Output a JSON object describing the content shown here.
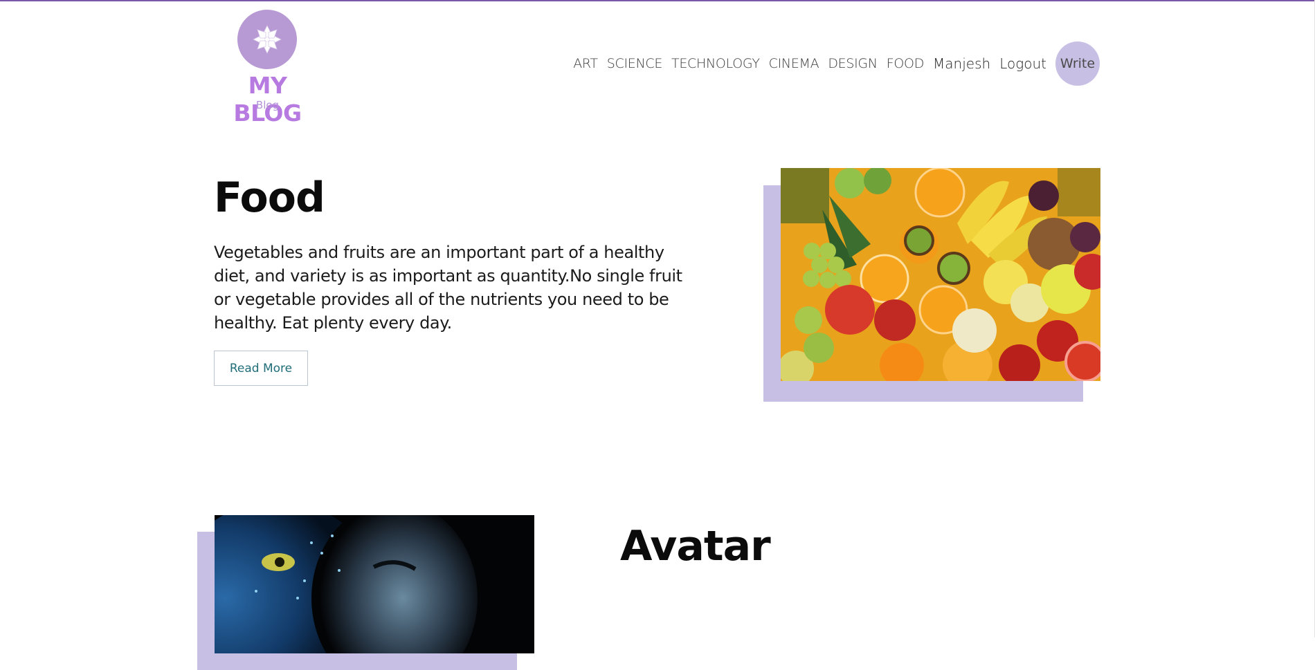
{
  "brand": {
    "title": "MY BLOG",
    "subtitle": "Blog",
    "logo_icon": "lotus-flower-icon",
    "accent_color": "#b79ad4"
  },
  "nav": {
    "categories": [
      "ART",
      "SCIENCE",
      "TECHNOLOGY",
      "CINEMA",
      "DESIGN",
      "FOOD"
    ],
    "username": "Manjesh",
    "logout": "Logout",
    "write": "Write",
    "write_bg": "#c8c0e4"
  },
  "posts": [
    {
      "title": "Food",
      "description": "Vegetables and fruits are an important part of a healthy diet, and variety is as important as quantity.No single fruit or vegetable provides all of the nutrients you need to be healthy. Eat plenty every day.",
      "button": "Read More",
      "image": "assorted-fruits-photo"
    },
    {
      "title": "Avatar",
      "image": "avatar-movie-poster"
    }
  ]
}
